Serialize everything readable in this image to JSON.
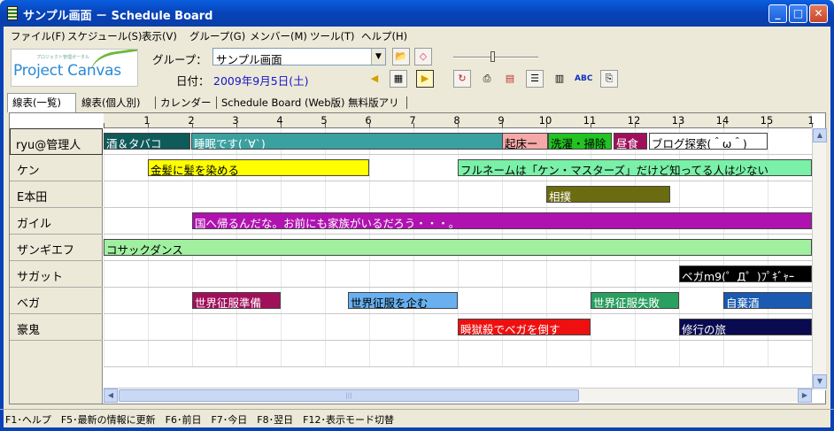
{
  "window": {
    "title": "サンプル画面 － Schedule Board"
  },
  "menu": [
    "ファイル(F)",
    "スケジュール(S)",
    "表示(V)",
    "グループ(G)",
    "メンバー(M)",
    "ツール(T)",
    "ヘルプ(H)"
  ],
  "logo_text": "Project Canvas",
  "logo_subtext": "プロジェクト管理ポータル",
  "toolbar": {
    "group_label": "グループ：",
    "group_value": "サンプル画面",
    "date_label": "日付：",
    "date_value": "2009年9月5日(土)"
  },
  "tabs": [
    "線表(一覧)",
    "線表(個人別)",
    "カレンダー",
    "Schedule Board (Web版) 無料版アリ"
  ],
  "hours": [
    "1",
    "2",
    "3",
    "4",
    "5",
    "6",
    "7",
    "8",
    "9",
    "10",
    "11",
    "12",
    "13",
    "14",
    "15",
    "1"
  ],
  "members": [
    "ryu@管理人",
    "ケン",
    "E本田",
    "ガイル",
    "ザンギエフ",
    "サガット",
    "ベガ",
    "豪鬼"
  ],
  "events": [
    {
      "row": 0,
      "text": "酒＆タバコ",
      "bg": "#0f5a5a",
      "fg": "#ffffff"
    },
    {
      "row": 0,
      "text": "睡眠です(´∀`)",
      "bg": "#3aa0a0",
      "fg": "#ffffff"
    },
    {
      "row": 0,
      "text": "起床ー",
      "bg": "#f5a8a8",
      "fg": "#000000"
    },
    {
      "row": 0,
      "text": "洗濯・掃除",
      "bg": "#22c322",
      "fg": "#000000"
    },
    {
      "row": 0,
      "text": "昼食",
      "bg": "#a0105a",
      "fg": "#ffffff"
    },
    {
      "row": 0,
      "text": "ブログ探索(＾ω＾)",
      "bg": "#ffffff",
      "fg": "#000000"
    },
    {
      "row": 1,
      "text": "金髪に髪を染める",
      "bg": "#ffff00",
      "fg": "#000000"
    },
    {
      "row": 1,
      "text": "フルネームは「ケン・マスターズ」だけど知ってる人は少ない",
      "bg": "#7af0a8",
      "fg": "#000000"
    },
    {
      "row": 2,
      "text": "相撲",
      "bg": "#6b6b10",
      "fg": "#ffffff"
    },
    {
      "row": 3,
      "text": "国へ帰るんだな。お前にも家族がいるだろう・・・。",
      "bg": "#b012b0",
      "fg": "#ffffff"
    },
    {
      "row": 4,
      "text": "コサックダンス",
      "bg": "#a0f0a0",
      "fg": "#000000"
    },
    {
      "row": 5,
      "text": "ベガm9(゜Д゜)ﾌﾟｷﾞｬｰ",
      "bg": "#000000",
      "fg": "#ffffff"
    },
    {
      "row": 6,
      "text": "世界征服準備",
      "bg": "#a0105a",
      "fg": "#ffffff"
    },
    {
      "row": 6,
      "text": "世界征服を企む",
      "bg": "#68b0f0",
      "fg": "#000000"
    },
    {
      "row": 6,
      "text": "世界征服失敗",
      "bg": "#2aa060",
      "fg": "#ffffff"
    },
    {
      "row": 6,
      "text": "自棄酒",
      "bg": "#1a5ab0",
      "fg": "#ffffff"
    },
    {
      "row": 7,
      "text": "瞬獄殺でベガを倒す",
      "bg": "#ee1010",
      "fg": "#ffffff"
    },
    {
      "row": 7,
      "text": "修行の旅",
      "bg": "#0a0a50",
      "fg": "#ffffff"
    }
  ],
  "statusbar": "F1･ヘルプ　F5･最新の情報に更新　F6･前日　F7･今日　F8･翌日　F12･表示モード切替"
}
